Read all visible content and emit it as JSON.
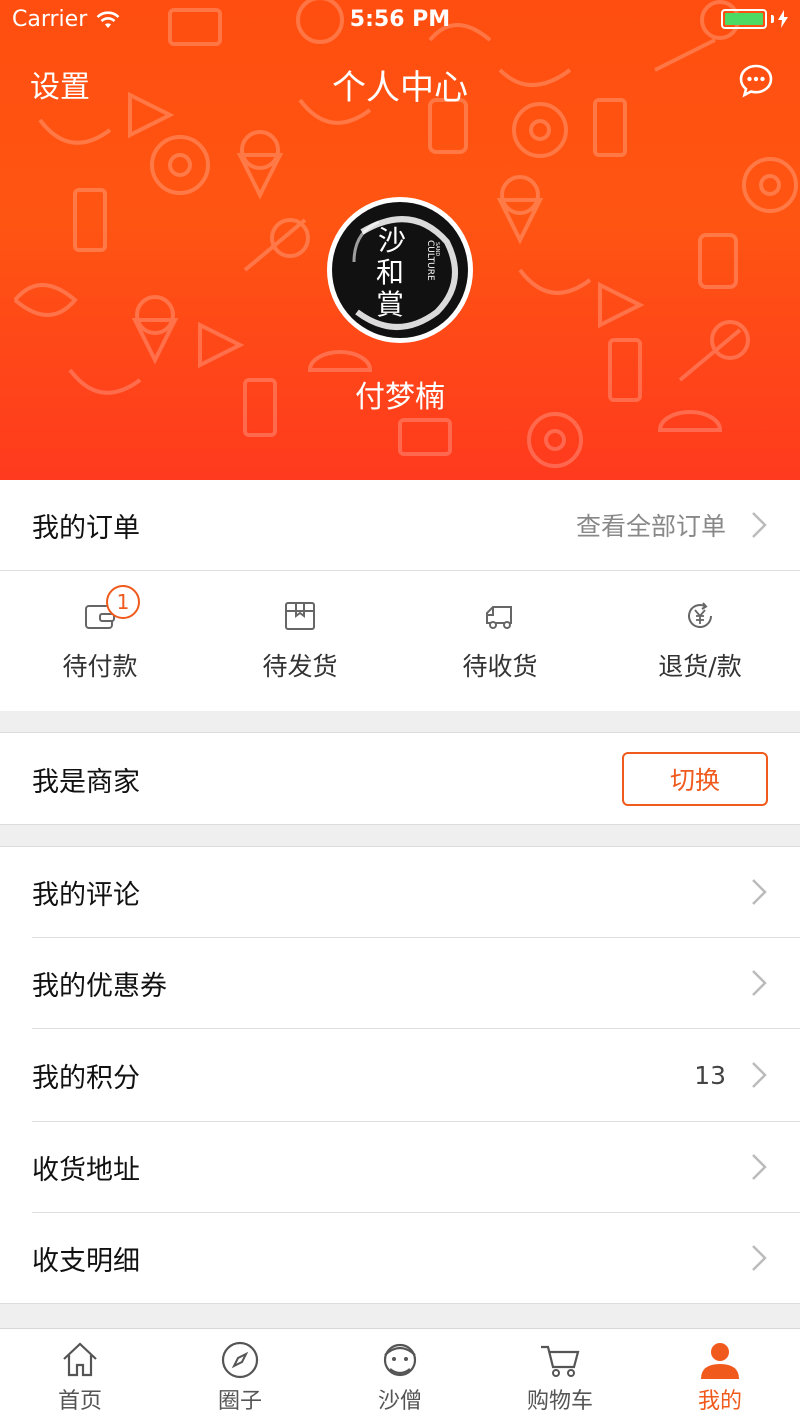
{
  "status_bar": {
    "carrier": "Carrier",
    "time": "5:56 PM"
  },
  "nav": {
    "left": "设置",
    "title": "个人中心",
    "right_icon": "message-icon"
  },
  "profile": {
    "name": "付梦楠",
    "avatar_text": [
      "沙",
      "和",
      "賞"
    ],
    "avatar_side": "CULTURE",
    "avatar_side_small": "SAND"
  },
  "orders": {
    "title": "我的订单",
    "view_all": "查看全部订单",
    "items": [
      {
        "label": "待付款",
        "icon": "wallet-icon",
        "badge": "1"
      },
      {
        "label": "待发货",
        "icon": "box-icon"
      },
      {
        "label": "待收货",
        "icon": "truck-icon"
      },
      {
        "label": "退货/款",
        "icon": "refund-yen-icon"
      }
    ]
  },
  "merchant": {
    "label": "我是商家",
    "button": "切换"
  },
  "menu": [
    {
      "label": "我的评论",
      "value": ""
    },
    {
      "label": "我的优惠券",
      "value": ""
    },
    {
      "label": "我的积分",
      "value": "13"
    },
    {
      "label": "收货地址",
      "value": ""
    },
    {
      "label": "收支明细",
      "value": ""
    }
  ],
  "tabs": [
    {
      "label": "首页",
      "icon": "home-icon"
    },
    {
      "label": "圈子",
      "icon": "compass-icon"
    },
    {
      "label": "沙僧",
      "icon": "monk-icon"
    },
    {
      "label": "购物车",
      "icon": "cart-icon"
    },
    {
      "label": "我的",
      "icon": "person-icon",
      "active": true
    }
  ],
  "colors": {
    "accent": "#f05a1c",
    "header_top": "#ff4e10",
    "header_bottom": "#ff3a1e",
    "battery": "#4cd964"
  }
}
